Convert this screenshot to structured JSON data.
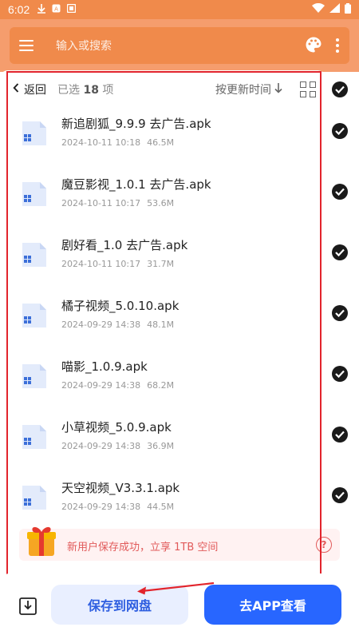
{
  "status_bar": {
    "time": "6:02",
    "icons": [
      "download-icon",
      "app-icon",
      "notification-icon",
      "wifi-icon",
      "signal-icon",
      "battery-icon"
    ]
  },
  "toolbar": {
    "search_placeholder": "输入或搜索",
    "icons": [
      "menu-icon",
      "palette-icon",
      "more-icon"
    ]
  },
  "header": {
    "back_label": "返回",
    "selected_prefix": "已选",
    "selected_count": "18",
    "selected_suffix": "项",
    "sort_label": "按更新时间"
  },
  "files": [
    {
      "name": "新追剧狐_9.9.9 去广告.apk",
      "date": "2024-10-11 10:18",
      "size": "46.5M",
      "checked": true
    },
    {
      "name": "魔豆影视_1.0.1 去广告.apk",
      "date": "2024-10-11 10:17",
      "size": "53.6M",
      "checked": true
    },
    {
      "name": "剧好看_1.0 去广告.apk",
      "date": "2024-10-11 10:17",
      "size": "31.7M",
      "checked": true
    },
    {
      "name": "橘子视频_5.0.10.apk",
      "date": "2024-09-29 14:38",
      "size": "48.1M",
      "checked": true
    },
    {
      "name": "喵影_1.0.9.apk",
      "date": "2024-09-29 14:38",
      "size": "68.2M",
      "checked": true
    },
    {
      "name": "小草视频_5.0.9.apk",
      "date": "2024-09-29 14:38",
      "size": "36.9M",
      "checked": true
    },
    {
      "name": "天空视频_V3.3.1.apk",
      "date": "2024-09-29 14:38",
      "size": "44.5M",
      "checked": true
    }
  ],
  "promo": {
    "text": "新用户保存成功，立享 1TB 空间",
    "help": "?"
  },
  "actions": {
    "save_label": "保存到网盘",
    "app_label": "去APP查看"
  },
  "colors": {
    "accent_orange": "#f08a4b",
    "primary_blue": "#2866ff",
    "annotation_red": "#e2242c"
  }
}
